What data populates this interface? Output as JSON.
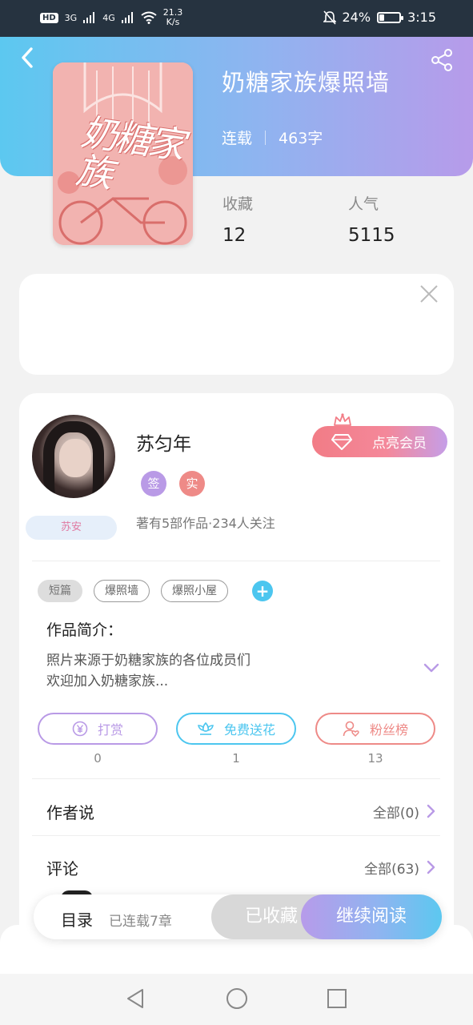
{
  "status_bar": {
    "hd": "HD",
    "hd_sub": "2",
    "net1": "3G",
    "net2": "4G",
    "speed_value": "21.3",
    "speed_unit": "K/s",
    "battery_percent": "24%",
    "battery_level": 0.24,
    "time": "3:15"
  },
  "book": {
    "title": "奶糖家族爆照墙",
    "status": "连载",
    "word_count": "463字",
    "cover_text": "奶糖家族",
    "favorites_label": "收藏",
    "favorites_value": "12",
    "popularity_label": "人气",
    "popularity_value": "5115"
  },
  "author": {
    "name": "苏匀年",
    "badge_sign": "签",
    "badge_real": "实",
    "name_tag": "苏安",
    "info": "著有5部作品·234人关注",
    "vip_label": "点亮会员"
  },
  "tags": [
    "短篇",
    "爆照墙",
    "爆照小屋"
  ],
  "tag_add": "+",
  "intro": {
    "heading": "作品简介：",
    "line1": "照片来源于奶糖家族的各位成员们",
    "line2": "欢迎加入奶糖家族..."
  },
  "actions": [
    {
      "label": "打赏",
      "count": "0",
      "icon": "yuan-icon",
      "color": "#b99ae6"
    },
    {
      "label": "免费送花",
      "count": "1",
      "icon": "flower-icon",
      "color": "#4cc6ef"
    },
    {
      "label": "粉丝榜",
      "count": "13",
      "icon": "fans-icon",
      "color": "#ee8a87"
    }
  ],
  "rows": {
    "author_says_label": "作者说",
    "author_says_right": "全部(0)",
    "comments_label": "评论",
    "comments_right": "全部(63)"
  },
  "bottom_bar": {
    "toc_label": "目录",
    "chapters_label": "已连载7章",
    "favorited_label": "已收藏",
    "continue_label": "继续阅读"
  },
  "colors": {
    "header_gradient_start": "#5cc8f0",
    "header_gradient_end": "#b79bea",
    "vip_start": "#f27c86",
    "accent_blue": "#4cc6ef"
  }
}
